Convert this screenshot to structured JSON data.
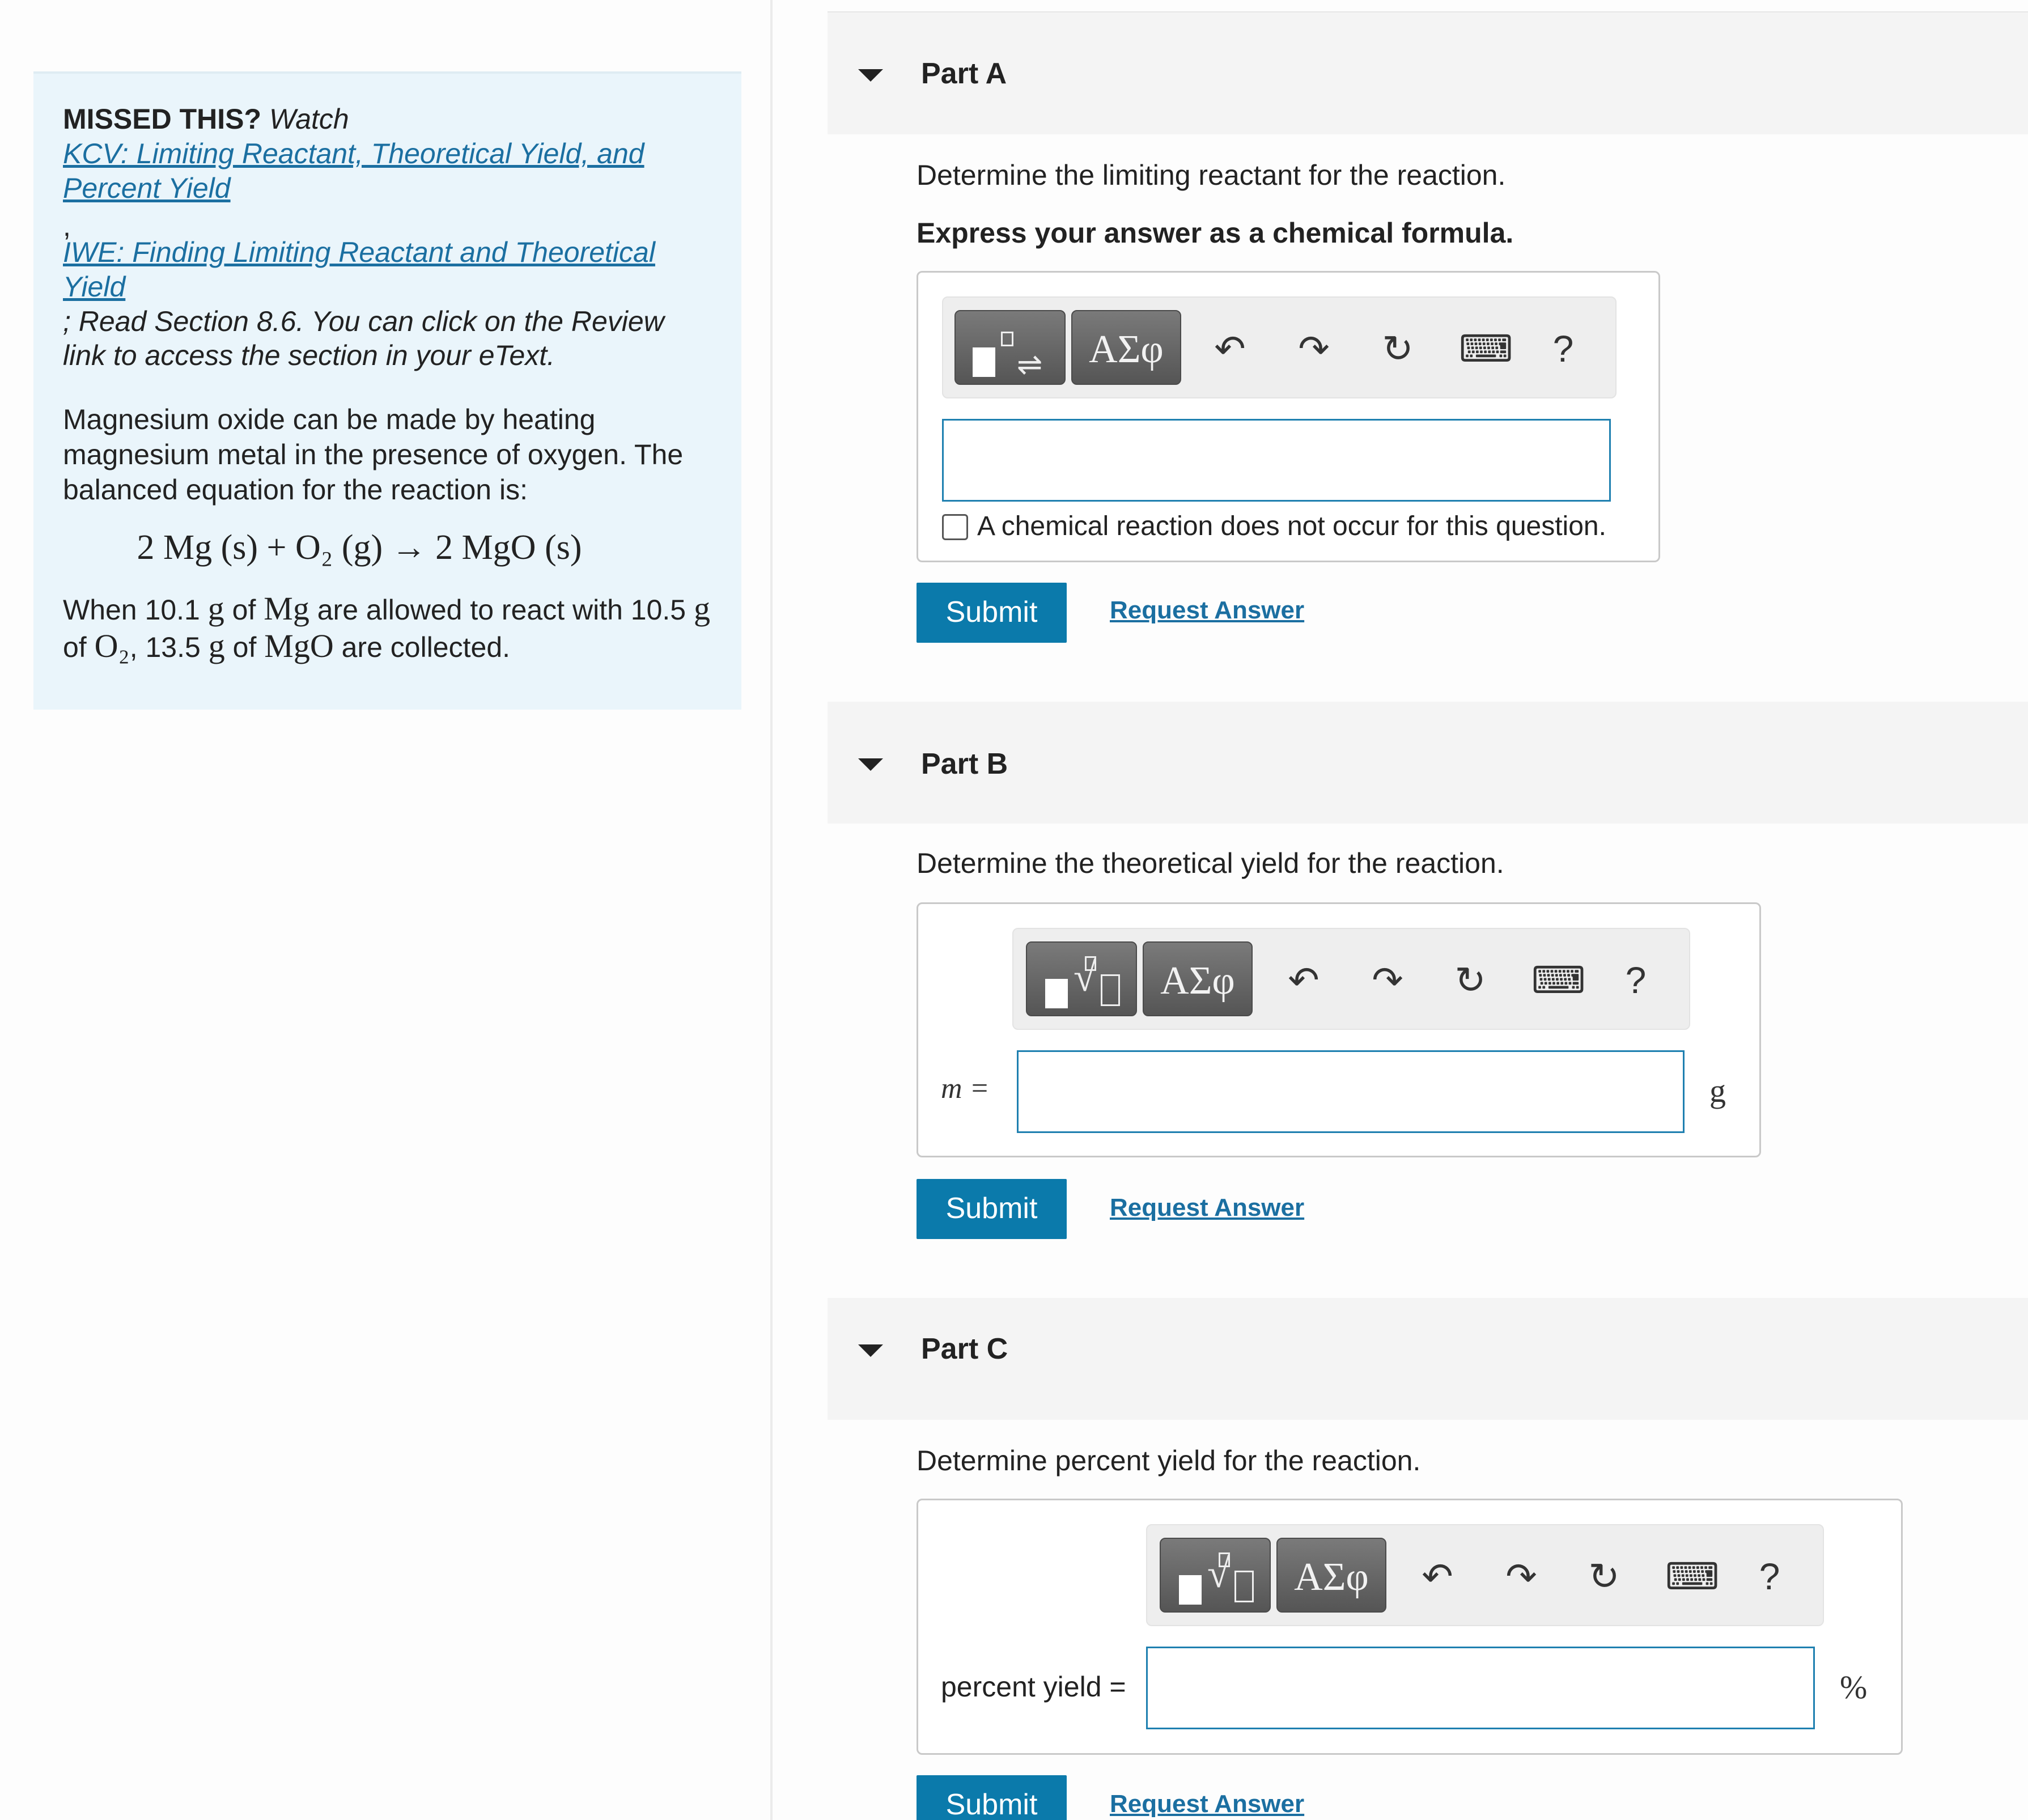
{
  "hint": {
    "missed_label": "MISSED THIS?",
    "watch_label": "Watch",
    "link1": "KCV: Limiting Reactant, Theoretical Yield, and Percent Yield",
    "separator": ",",
    "link2": "IWE: Finding Limiting Reactant and Theoretical Yield",
    "read_text": "; Read Section 8.6. You can click on the Review link to access the section in your eText.",
    "intro": "Magnesium oxide can be made by heating magnesium metal in the presence of oxygen. The balanced equation for the reaction is:",
    "equation": "2 Mg (s) + O₂ (g) → 2 MgO (s)",
    "when_1": "When 10.1",
    "when_g1": "g",
    "when_2": "of",
    "when_mg": "Mg",
    "when_3": "are allowed to react with 10.5",
    "when_g2": "g",
    "when_4": "of",
    "when_o2": "O₂",
    "when_5": ", 13.5",
    "when_g3": "g",
    "when_6": "of",
    "when_mgo": "MgO",
    "when_7": "are collected."
  },
  "parts": {
    "a": {
      "title": "Part A",
      "question": "Determine the limiting reactant for the reaction.",
      "instruction": "Express your answer as a chemical formula.",
      "input_value": "",
      "checkbox_label": "A chemical reaction does not occur for this question.",
      "submit": "Submit",
      "request": "Request Answer"
    },
    "b": {
      "title": "Part B",
      "question": "Determine the theoretical yield for the reaction.",
      "var_label": "m =",
      "unit": "g",
      "input_value": "",
      "submit": "Submit",
      "request": "Request Answer"
    },
    "c": {
      "title": "Part C",
      "question": "Determine percent yield for the reaction.",
      "var_label": "percent yield =",
      "unit": "%",
      "input_value": "",
      "submit": "Submit",
      "request": "Request Answer"
    }
  },
  "toolbar": {
    "greek": "ΑΣφ",
    "help": "?",
    "icons": [
      "templates-icon",
      "greek-letters-icon",
      "undo-icon",
      "redo-icon",
      "reset-icon",
      "keyboard-icon",
      "help-icon"
    ]
  }
}
